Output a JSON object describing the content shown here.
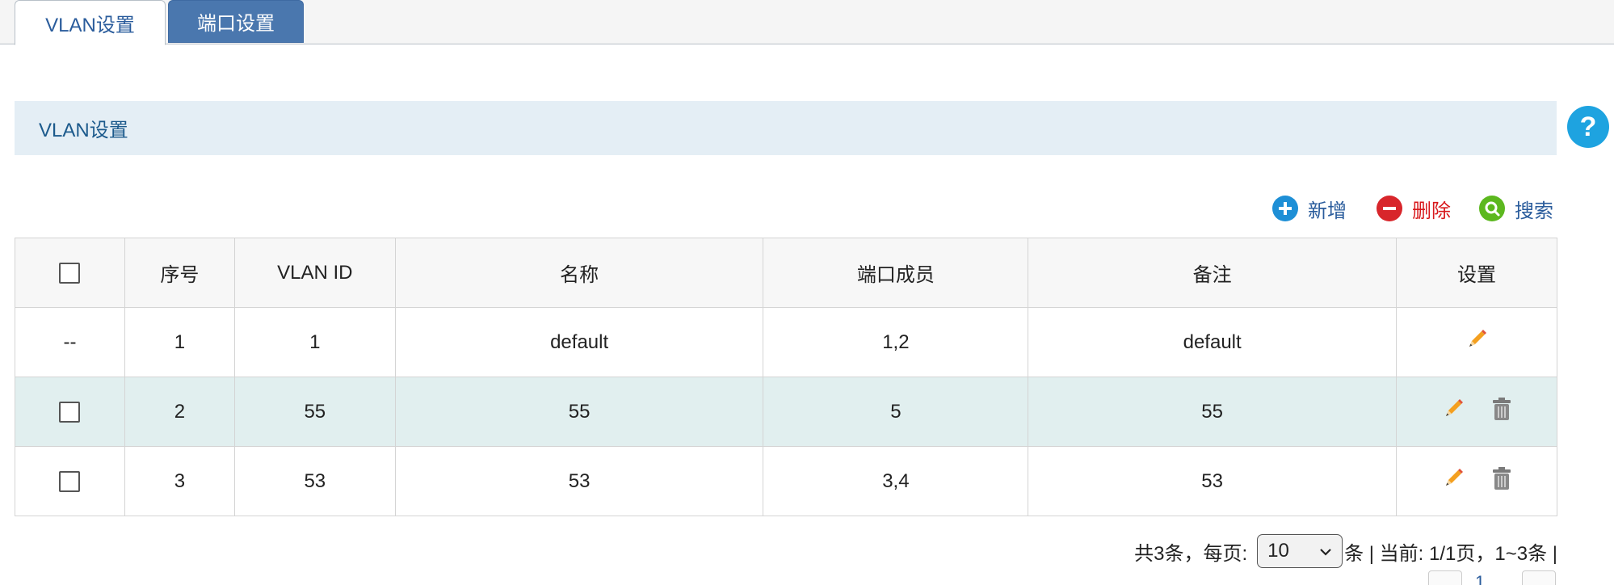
{
  "tabs": [
    {
      "label": "VLAN设置",
      "active": true
    },
    {
      "label": "端口设置",
      "active": false
    }
  ],
  "section": {
    "title": "VLAN设置"
  },
  "help": {
    "label": "?"
  },
  "toolbar": {
    "add_label": "新增",
    "delete_label": "删除",
    "search_label": "搜索"
  },
  "table": {
    "headers": {
      "index": "序号",
      "vlan_id": "VLAN ID",
      "name": "名称",
      "ports": "端口成员",
      "remark": "备注",
      "settings": "设置"
    },
    "rows": [
      {
        "select": "--",
        "index": "1",
        "vlan_id": "1",
        "name": "default",
        "ports": "1,2",
        "remark": "default"
      },
      {
        "select": "",
        "index": "2",
        "vlan_id": "55",
        "name": "55",
        "ports": "5",
        "remark": "55"
      },
      {
        "select": "",
        "index": "3",
        "vlan_id": "53",
        "name": "53",
        "ports": "3,4",
        "remark": "53"
      }
    ]
  },
  "pagination": {
    "total_text": "共3条，每页:",
    "page_size": "10",
    "after_select_text": "条 | 当前: 1/1页，1~3条 |",
    "current_page": "1"
  },
  "colors": {
    "accent": "#2a5c9c",
    "tab_inactive": "#4a77ae",
    "header_band": "#e4eef5",
    "highlight_row": "#e1efef",
    "delete": "#d8191c",
    "help": "#1ea3e0"
  },
  "icons": {
    "add": "plus-circle-icon",
    "delete": "minus-circle-icon",
    "search": "magnifier-icon",
    "edit": "pencil-icon",
    "trash": "trash-icon",
    "help": "question-icon"
  }
}
